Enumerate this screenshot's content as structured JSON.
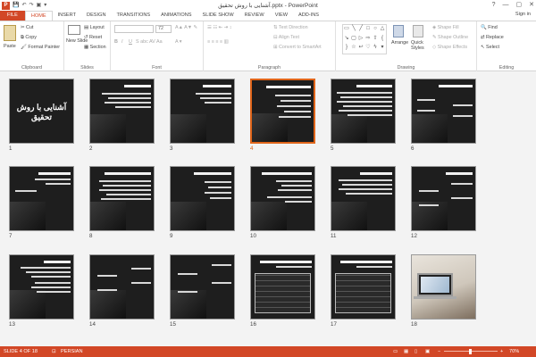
{
  "titlebar": {
    "title": "آشنایی با روش تحقیق.pptx - PowerPoint",
    "app_icon": "P",
    "controls": [
      "?",
      "—",
      "▢",
      "✕"
    ]
  },
  "tabs": [
    "FILE",
    "HOME",
    "INSERT",
    "DESIGN",
    "TRANSITIONS",
    "ANIMATIONS",
    "SLIDE SHOW",
    "REVIEW",
    "VIEW",
    "ADD-INS"
  ],
  "active_tab": "HOME",
  "signin": "Sign in",
  "ribbon": {
    "clipboard": {
      "label": "Clipboard",
      "paste": "Paste",
      "cut": "Cut",
      "copy": "Copy",
      "format_painter": "Format Painter"
    },
    "slides": {
      "label": "Slides",
      "new_slide": "New Slide",
      "layout": "Layout",
      "reset": "Reset",
      "section": "Section"
    },
    "font": {
      "label": "Font",
      "size": "72"
    },
    "paragraph": {
      "label": "Paragraph",
      "text_direction": "Text Direction",
      "align_text": "Align Text",
      "convert_smartart": "Convert to SmartArt"
    },
    "drawing": {
      "label": "Drawing",
      "arrange": "Arrange",
      "quick_styles": "Quick Styles",
      "shape_fill": "Shape Fill",
      "shape_outline": "Shape Outline",
      "shape_effects": "Shape Effects"
    },
    "editing": {
      "label": "Editing",
      "find": "Find",
      "replace": "Replace",
      "select": "Select"
    }
  },
  "slides": [
    {
      "num": "1",
      "title": "آشنایی با روش تحقیق"
    },
    {
      "num": "2",
      "title": "روش پژوهش"
    },
    {
      "num": "3",
      "title": "فوائد پژوهش"
    },
    {
      "num": "4",
      "title": "عناصر موثر در طرح پژوهش"
    },
    {
      "num": "5",
      "title": ""
    },
    {
      "num": "6",
      "title": "مراحل انجام پژوهش"
    },
    {
      "num": "7",
      "title": ""
    },
    {
      "num": "8",
      "title": "مراحل تحقیق از نگاهی دیگر"
    },
    {
      "num": "9",
      "title": ""
    },
    {
      "num": "10",
      "title": ""
    },
    {
      "num": "11",
      "title": ""
    },
    {
      "num": "12",
      "title": ""
    },
    {
      "num": "13",
      "title": ""
    },
    {
      "num": "14",
      "title": ""
    },
    {
      "num": "15",
      "title": ""
    },
    {
      "num": "16",
      "title": ""
    },
    {
      "num": "17",
      "title": ""
    },
    {
      "num": "18",
      "title": ""
    }
  ],
  "selected_slide": "4",
  "status": {
    "slide_info": "SLIDE 4 OF 18",
    "language": "PERSIAN",
    "zoom": "70%"
  },
  "colors": {
    "accent": "#d24726",
    "selection": "#e0651a"
  }
}
